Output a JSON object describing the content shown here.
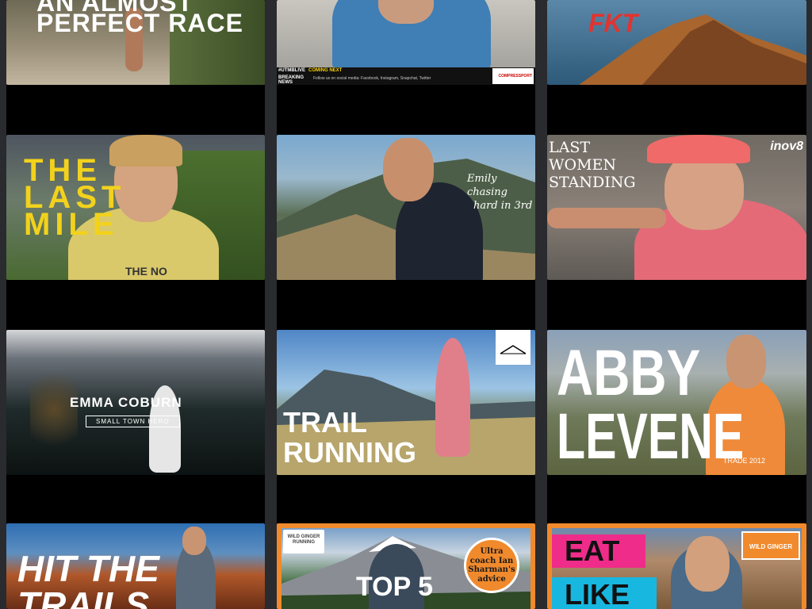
{
  "tiles": [
    {
      "title": "AN ALMOST PERFECT RACE",
      "line1": "AN ALMOST",
      "line2": "PERFECT RACE"
    },
    {
      "ticker_label": "#UTMBLIVE",
      "coming_next": "COMING NEXT",
      "breaking": "BREAKING NEWS",
      "ticker_text": "Follow us on social media: Facebook, Instagram, Snapchat, Twitter",
      "brand": "COMPRESSPORT"
    },
    {
      "title": "FKT"
    },
    {
      "title": "THE LAST MILE",
      "line1": "THE",
      "line2": "LAST",
      "line3": "MILE",
      "shirt": "THE NO"
    },
    {
      "caption_line1": "Emily chasing",
      "caption_line2": "hard in 3rd"
    },
    {
      "title": "LAST WOMEN STANDING",
      "line1": "LAST",
      "line2": "WOMEN",
      "line3": "STANDING",
      "brand": "inov8"
    },
    {
      "title": "EMMA COBURN",
      "subtitle": "SMALL TOWN HERO"
    },
    {
      "title": "TRAIL RUNNING",
      "line1": "TRAIL",
      "line2": "RUNNING"
    },
    {
      "title": "ABBY LEVENE",
      "line1": "ABBY",
      "line2": "LEVENE",
      "shirt": "TRADE 2012"
    },
    {
      "title": "HIT THE TRAILS",
      "line1": "HIT THE",
      "line2": "TRAILS"
    },
    {
      "brand_line1": "WILD GINGER",
      "brand_line2": "RUNNING",
      "title": "TOP 5",
      "badge": "Ultra coach Ian Sharman's advice"
    },
    {
      "title_line1": "EAT",
      "title_line2": "LIKE",
      "brand": "WILD GINGER"
    }
  ]
}
